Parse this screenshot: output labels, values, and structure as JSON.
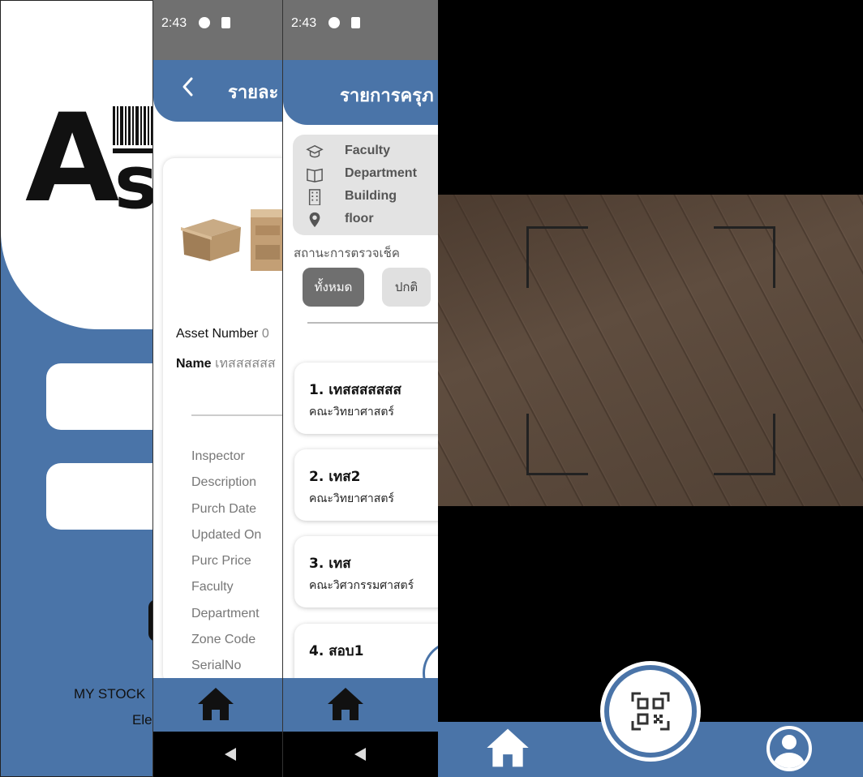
{
  "login": {
    "footer_line1": "MY STOCK",
    "footer_line2": "Ele"
  },
  "detail": {
    "status_time": "2:43",
    "header_title": "รายละ",
    "back_icon": "chevron-left-icon",
    "asset_number_label": "Asset Number",
    "asset_number_value": "0",
    "name_label": "Name",
    "name_value": "เทสสสสสส",
    "fields": [
      "Inspector",
      "Description",
      "Purch Date",
      "Updated On",
      "Purc Price",
      "Faculty",
      "Department",
      "Zone Code",
      "SerialNo"
    ]
  },
  "list": {
    "status_time": "2:43",
    "header_title": "รายการครุภ",
    "filters": [
      {
        "icon": "graduation-cap-icon",
        "label": "Faculty"
      },
      {
        "icon": "book-icon",
        "label": "Department"
      },
      {
        "icon": "building-icon",
        "label": "Building"
      },
      {
        "icon": "location-pin-icon",
        "label": "floor"
      }
    ],
    "status_label": "สถานะการตรวจเช็ค",
    "chips": [
      "ทั้งหมด",
      "ปกติ"
    ],
    "items": [
      {
        "title": "1. เทสสสสสสส",
        "subtitle": "คณะวิทยาศาสตร์"
      },
      {
        "title": "2. เทส2",
        "subtitle": "คณะวิทยาศาสตร์"
      },
      {
        "title": "3. เทส",
        "subtitle": "คณะวิศวกรรมศาสตร์"
      },
      {
        "title": "4. สอบ1",
        "subtitle": ""
      }
    ]
  },
  "colors": {
    "brand_blue": "#4a74a8",
    "status_gray": "#707070"
  }
}
